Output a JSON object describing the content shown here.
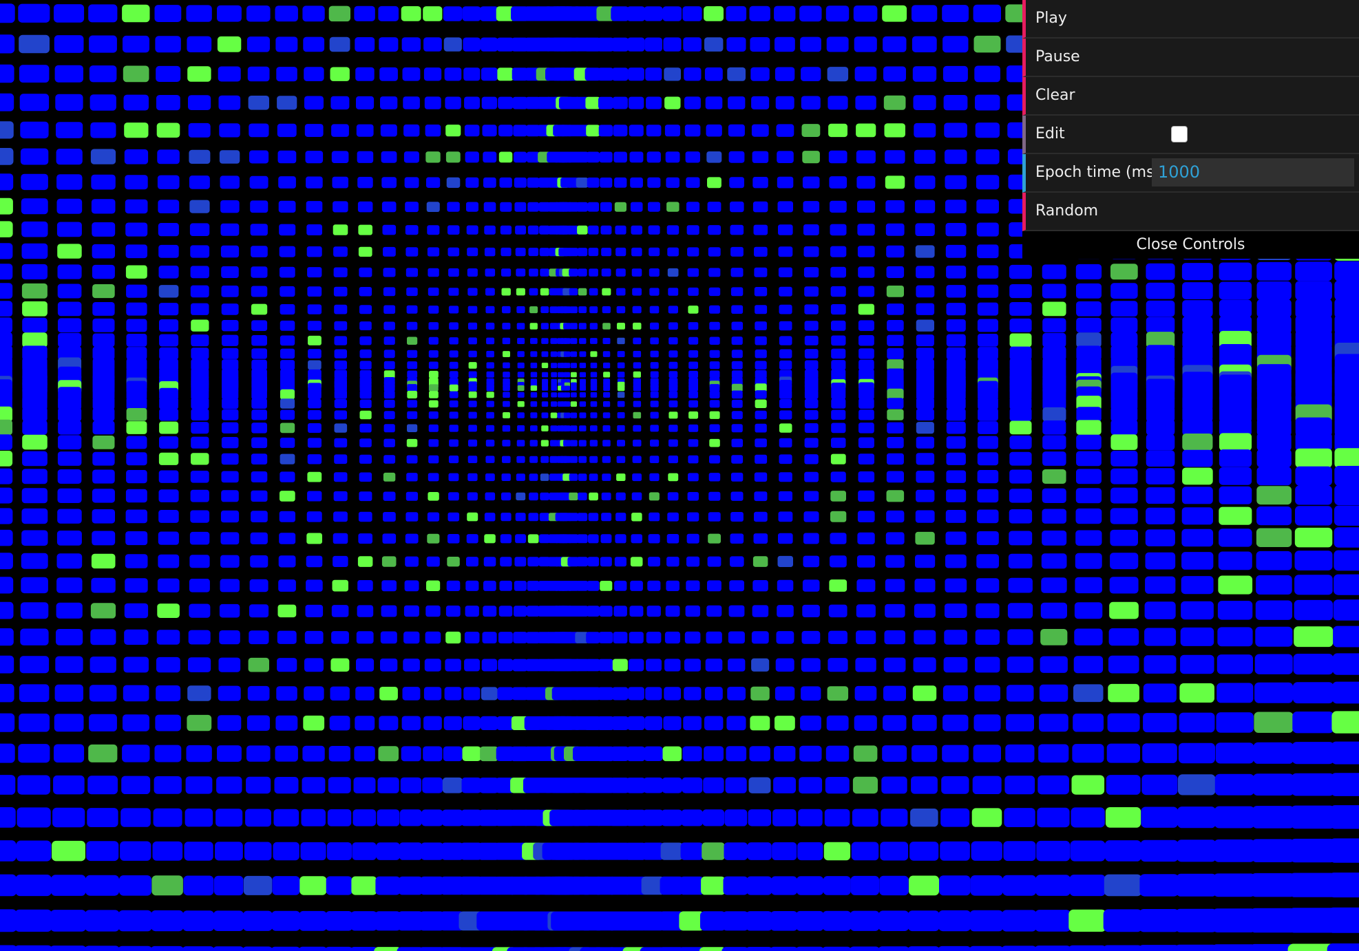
{
  "scene": {
    "background": "#000000",
    "cell_dead_color": "#0000ff",
    "cell_alive_color": "#66ff44",
    "cell_alive_dim_color": "#4fb84a",
    "cell_transition_color": "#2244cc"
  },
  "controls": {
    "play_label": "Play",
    "pause_label": "Pause",
    "clear_label": "Clear",
    "edit_label": "Edit",
    "edit_checked": false,
    "epoch_label": "Epoch time (ms)",
    "epoch_value": "1000",
    "random_label": "Random",
    "close_label": "Close Controls"
  }
}
